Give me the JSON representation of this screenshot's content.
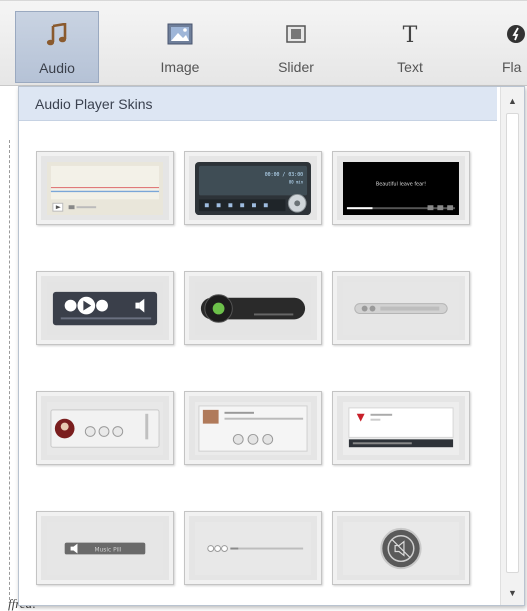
{
  "toolbar": {
    "items": [
      {
        "label": "Audio",
        "icon": "music-note-icon",
        "active": true
      },
      {
        "label": "Image",
        "icon": "image-icon",
        "active": false
      },
      {
        "label": "Slider",
        "icon": "slider-icon",
        "active": false
      },
      {
        "label": "Text",
        "icon": "text-icon",
        "active": false
      },
      {
        "label": "Fla",
        "icon": "flash-icon",
        "active": false
      }
    ]
  },
  "panel": {
    "title": "Audio Player Skins",
    "scroll_up": "▲",
    "scroll_down": "▼"
  },
  "skins": [
    {
      "name": "skin-light-bars"
    },
    {
      "name": "skin-dark-lcd",
      "time": "00:00 / 03:00",
      "text": "00 min"
    },
    {
      "name": "skin-black-video",
      "text": "Beautiful leave fear!"
    },
    {
      "name": "skin-dark-round-controls"
    },
    {
      "name": "skin-black-capsule"
    },
    {
      "name": "skin-grey-slim"
    },
    {
      "name": "skin-album-art-buttons"
    },
    {
      "name": "skin-playlist-panel"
    },
    {
      "name": "skin-banner-player"
    },
    {
      "name": "skin-music-pill",
      "text": "Music Pill"
    },
    {
      "name": "skin-minimal-line"
    },
    {
      "name": "skin-round-disc"
    }
  ],
  "background": {
    "bottom_text": "ffrea!"
  }
}
